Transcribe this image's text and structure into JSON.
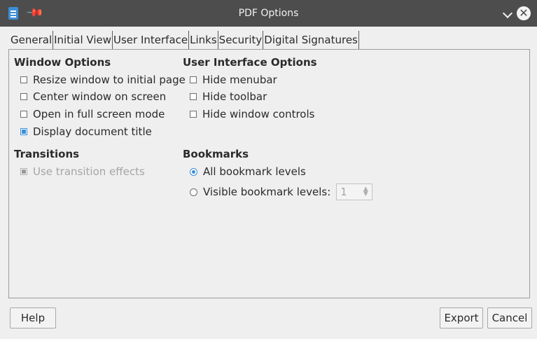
{
  "window": {
    "title": "PDF Options"
  },
  "tabs": [
    {
      "label": "General"
    },
    {
      "label": "Initial View"
    },
    {
      "label": "User Interface"
    },
    {
      "label": "Links"
    },
    {
      "label": "Security"
    },
    {
      "label": "Digital Signatures"
    }
  ],
  "window_options": {
    "title": "Window Options",
    "items": [
      {
        "label": "Resize window to initial page",
        "checked": false
      },
      {
        "label": "Center window on screen",
        "checked": false
      },
      {
        "label": "Open in full screen mode",
        "checked": false
      },
      {
        "label": "Display document title",
        "checked": true
      }
    ]
  },
  "ui_options": {
    "title": "User Interface Options",
    "items": [
      {
        "label": "Hide menubar",
        "checked": false
      },
      {
        "label": "Hide toolbar",
        "checked": false
      },
      {
        "label": "Hide window controls",
        "checked": false
      }
    ]
  },
  "transitions": {
    "title": "Transitions",
    "item": {
      "label": "Use transition effects",
      "checked": true,
      "enabled": false
    }
  },
  "bookmarks": {
    "title": "Bookmarks",
    "all": {
      "label": "All bookmark levels",
      "selected": true
    },
    "visible": {
      "label": "Visible bookmark levels:",
      "selected": false,
      "value": "1"
    }
  },
  "buttons": {
    "help": "Help",
    "export": "Export",
    "cancel": "Cancel"
  },
  "colors": {
    "titlebar": "#4d4d4d",
    "accent": "#3d8fd6",
    "background": "#efefef"
  }
}
